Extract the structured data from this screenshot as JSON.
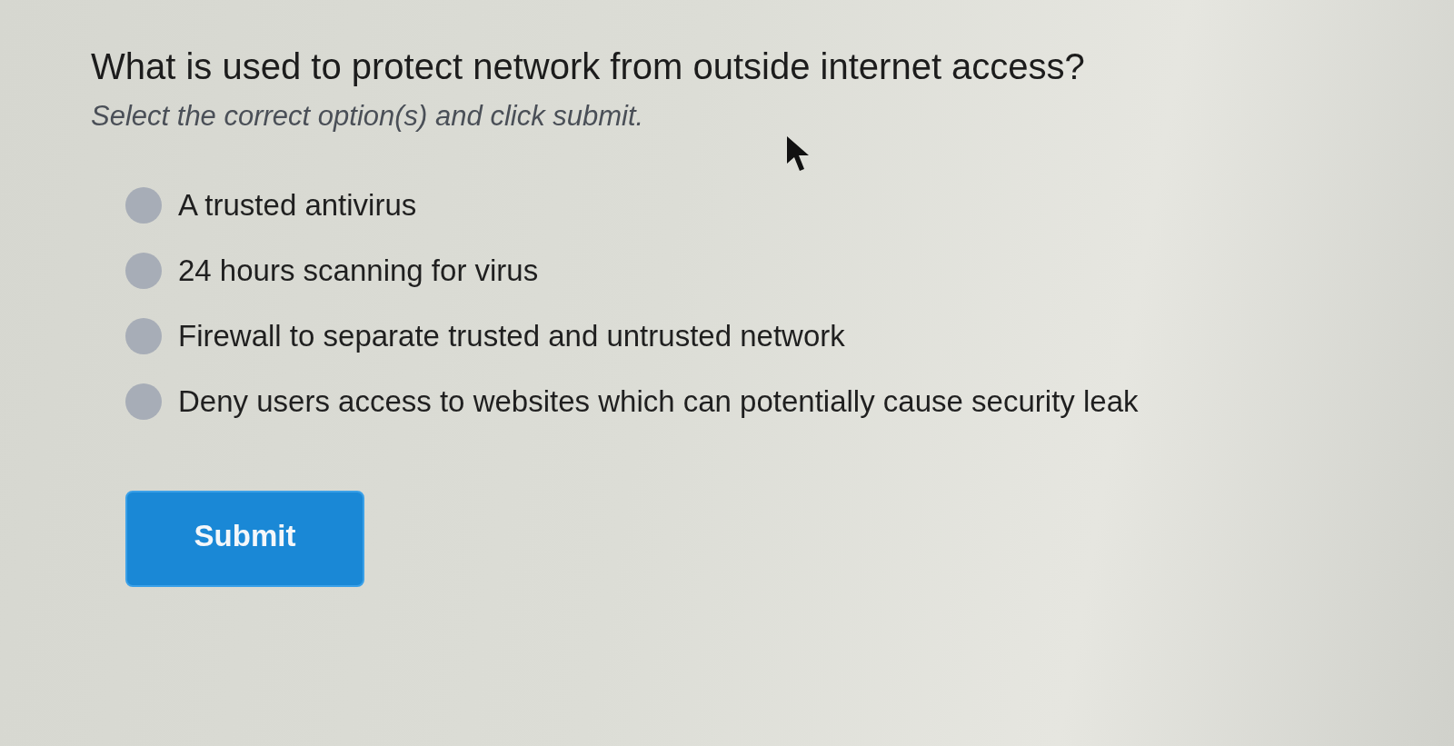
{
  "question": {
    "title": "What is used to protect network from outside internet access?",
    "instruction": "Select the correct option(s) and click submit."
  },
  "options": [
    {
      "label": "A trusted antivirus",
      "selected": false
    },
    {
      "label": "24 hours scanning for virus",
      "selected": false
    },
    {
      "label": "Firewall to separate trusted and untrusted network",
      "selected": false
    },
    {
      "label": "Deny users access to websites which can potentially cause security leak",
      "selected": false
    }
  ],
  "submit": {
    "label": "Submit"
  }
}
